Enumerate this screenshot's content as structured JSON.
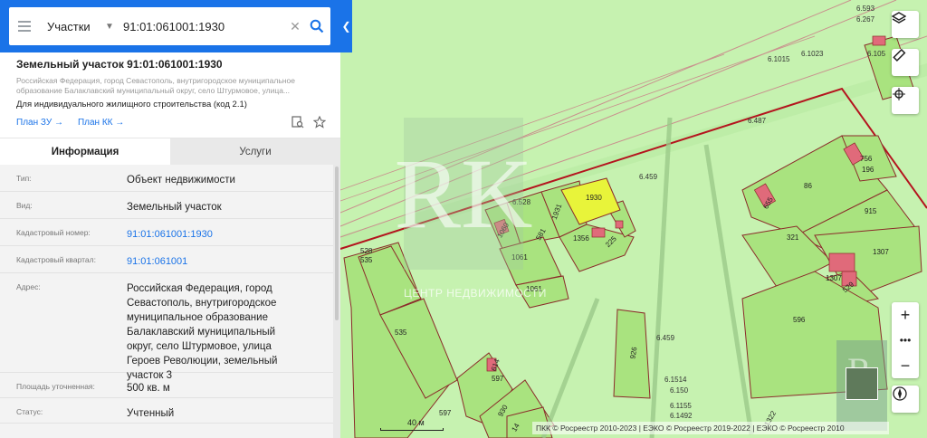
{
  "search": {
    "type": "Участки",
    "value": "91:01:061001:1930"
  },
  "parcel": {
    "title": "Земельный участок 91:01:061001:1930",
    "address_short": "Российская Федерация, город Севастополь, внутригородское муниципальное образование Балаклавский муниципальный округ, село Штурмовое, улица...",
    "purpose": "Для индивидуального жилищного строительства (код 2.1)",
    "link_zu": "План ЗУ →",
    "link_kk": "План КК →"
  },
  "tabs": [
    {
      "label": "Информация",
      "active": true
    },
    {
      "label": "Услуги",
      "active": false
    }
  ],
  "info": [
    {
      "key": "Тип:",
      "value": "Объект недвижимости"
    },
    {
      "key": "Вид:",
      "value": "Земельный участок"
    },
    {
      "key": "Кадастровый номер:",
      "value": "91:01:061001:1930"
    },
    {
      "key": "Кадастровый квартал:",
      "value": "91:01:061001"
    },
    {
      "key": "Адрес:",
      "value": "Российская Федерация, город Севастополь, внутригородское муниципальное образование Балаклавский муниципальный округ, село Штурмовое, улица Героев Революции, земельный участок 3"
    },
    {
      "key": "Площадь уточненная:",
      "value": "500 кв. м"
    },
    {
      "key": "Статус:",
      "value": "Учтенный"
    }
  ],
  "map": {
    "watermark_text": "ЦЕНТР НЕДВИЖИМОСТИ",
    "scale_label": "40 м",
    "attribution": "ПКК © Росреестр 2010-2023 | ЕЭКО © Росреестр 2019-2022 | ЕЭКО © Росреестр 2010",
    "plots": [
      "1930",
      "1931",
      "1060",
      "581",
      "1356",
      "225",
      "1061",
      "1061",
      "535",
      "535",
      "926",
      "614",
      "597",
      "597",
      "930",
      "14",
      "86",
      "915",
      "321",
      "1307",
      "1307",
      "529",
      "596",
      "756",
      "196",
      "655",
      "6.593",
      "6.267",
      "6.105",
      "6.1015",
      "6.1023",
      "6.487",
      "6.528",
      "6.459",
      "6.459",
      "6.1514",
      "6.150",
      "6.1155",
      "6.1492",
      "529",
      "6.98"
    ]
  },
  "colors": {
    "brand": "#1a73e8",
    "map_bg": "#c6f2b0",
    "parcel_fill": "#9fe07a",
    "selected_fill": "#e8f43a",
    "border_red": "#b4141e",
    "building_pink": "#e06a7a"
  },
  "icons": {
    "menu": "hamburger-icon",
    "search": "search-icon",
    "layers": "layers-icon",
    "ruler": "ruler-icon",
    "locate": "locate-icon",
    "compass": "compass-icon"
  }
}
